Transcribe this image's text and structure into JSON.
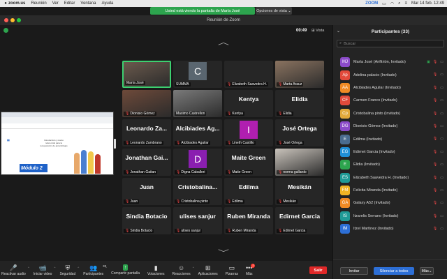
{
  "menubar": {
    "apple": "",
    "items": [
      "zoom.us",
      "Reunión",
      "Ver",
      "Editar",
      "Ventana",
      "Ayuda"
    ],
    "zoom_label": "ZOOM",
    "datetime": "Mar 14 feb.  12:49"
  },
  "share_banner": "Usted está viendo la pantalla de María José",
  "view_options": "Opciones de vista",
  "window_title": "Reunión de Zoom",
  "timer": "00:49",
  "view_label": "Vista",
  "shared_content": {
    "module": "Módulo 2",
    "headline": "Introducción y marco referencial para la recuperación de aprendizajes"
  },
  "tiles": [
    {
      "big": "",
      "label": "María José",
      "mic_muted": false,
      "kind": "photo",
      "color": "#6b5a4d"
    },
    {
      "big": "C",
      "label": "SUMMA",
      "mic_muted": false,
      "kind": "letter",
      "color": "#5a6670"
    },
    {
      "big": "",
      "label": "Elizabeth Saavedra H.",
      "mic_muted": true,
      "kind": "dark",
      "color": "#262626"
    },
    {
      "big": "",
      "label": "Marta Arauz",
      "mic_muted": true,
      "kind": "photo",
      "color": "#8a7360"
    },
    {
      "big": "",
      "label": "Dionisio Gómez",
      "mic_muted": true,
      "kind": "photo",
      "color": "#6e4a3a"
    },
    {
      "big": "",
      "label": "Maximo Castrellon",
      "mic_muted": false,
      "kind": "photo",
      "color": "#7a7a7a"
    },
    {
      "big": "Kentya",
      "label": "Kentya",
      "mic_muted": true,
      "kind": "name",
      "color": "#262626"
    },
    {
      "big": "Elidia",
      "label": "Elidia",
      "mic_muted": true,
      "kind": "name",
      "color": "#262626"
    },
    {
      "big": "Leonardo Za...",
      "label": "Leonardo Zambrano",
      "mic_muted": true,
      "kind": "name",
      "color": "#262626"
    },
    {
      "big": "Alcibiades Ag...",
      "label": "Alcibiades Aguilar",
      "mic_muted": true,
      "kind": "name",
      "color": "#262626"
    },
    {
      "big": "I",
      "label": "Lineth Castillo",
      "mic_muted": true,
      "kind": "letter",
      "color": "#b01fb0"
    },
    {
      "big": "José Ortega",
      "label": "José Ortega",
      "mic_muted": true,
      "kind": "name",
      "color": "#262626"
    },
    {
      "big": "Jonathan Gai...",
      "label": "Jonathan Gaitan",
      "mic_muted": true,
      "kind": "name",
      "color": "#262626"
    },
    {
      "big": "D",
      "label": "Digna Caballeri",
      "mic_muted": true,
      "kind": "letter",
      "color": "#8a1fb0"
    },
    {
      "big": "Maite Green",
      "label": "Maite Green",
      "mic_muted": true,
      "kind": "name",
      "color": "#262626"
    },
    {
      "big": "",
      "label": "norma gallardo",
      "mic_muted": true,
      "kind": "photo",
      "color": "#c9c3bb"
    },
    {
      "big": "Juan",
      "label": "Juan",
      "mic_muted": true,
      "kind": "name",
      "color": "#262626"
    },
    {
      "big": "Cristobalina...",
      "label": "Cristobalina pinto",
      "mic_muted": true,
      "kind": "name",
      "color": "#262626"
    },
    {
      "big": "Edilma",
      "label": "Edilma",
      "mic_muted": true,
      "kind": "name",
      "color": "#262626"
    },
    {
      "big": "Mesikán",
      "label": "Mesikán",
      "mic_muted": true,
      "kind": "name",
      "color": "#262626"
    },
    {
      "big": "Sindia Botacio",
      "label": "Sindia Botacio",
      "mic_muted": true,
      "kind": "name",
      "color": "#262626"
    },
    {
      "big": "ulises sanjur",
      "label": "ulises sanjur",
      "mic_muted": true,
      "kind": "name",
      "color": "#262626"
    },
    {
      "big": "Ruben Miranda",
      "label": "Ruben Miranda",
      "mic_muted": true,
      "kind": "name",
      "color": "#262626"
    },
    {
      "big": "Edirnet Garcia",
      "label": "Edirnet Garcia",
      "mic_muted": true,
      "kind": "name",
      "color": "#262626"
    }
  ],
  "toolbar": {
    "items": [
      {
        "label": "Reactivar audio",
        "icon": "mic-muted-icon",
        "glyph": "🎤",
        "red": true
      },
      {
        "label": "Iniciar video",
        "icon": "video-off-icon",
        "glyph": "📹",
        "red": true
      },
      {
        "label": "Seguridad",
        "icon": "shield-icon",
        "glyph": "⛨",
        "red": false
      },
      {
        "label": "Participantes",
        "icon": "participants-icon",
        "glyph": "👥",
        "red": false,
        "count": "33"
      },
      {
        "label": "Compartir pantalla",
        "icon": "share-screen-icon",
        "glyph": "↑",
        "red": false,
        "green": true
      },
      {
        "label": "Votaciones",
        "icon": "polls-icon",
        "glyph": "▮",
        "red": false
      },
      {
        "label": "Reacciones",
        "icon": "reactions-icon",
        "glyph": "☺",
        "red": false
      },
      {
        "label": "Aplicaciones",
        "icon": "apps-icon",
        "glyph": "⊞",
        "red": false
      },
      {
        "label": "Pizarras",
        "icon": "whiteboard-icon",
        "glyph": "▭",
        "red": false
      },
      {
        "label": "Más",
        "icon": "more-icon",
        "glyph": "•••",
        "red": false,
        "badge": "2"
      }
    ],
    "leave": "Salir"
  },
  "panel": {
    "title": "Participantes (33)",
    "search_placeholder": "Buscar",
    "participants": [
      {
        "initials": "MJ",
        "name": "María José (Anfitrión, Invitado)",
        "color": "#8b4bc9",
        "host": true
      },
      {
        "initials": "Ap",
        "name": "Adelina palacio (Invitado)",
        "color": "#e24a3b"
      },
      {
        "initials": "AA",
        "name": "Alcibiades Aguilar (Invitado)",
        "color": "#f08a24"
      },
      {
        "initials": "CF",
        "name": "Carmen Franco (Invitado)",
        "color": "#e24a3b"
      },
      {
        "initials": "Cp",
        "name": "Cristobalina pinto (Invitado)",
        "color": "#e2a93b"
      },
      {
        "initials": "DG",
        "name": "Dionisio Gómez (Invitado)",
        "color": "#8b4bc9"
      },
      {
        "initials": "E",
        "name": "Edilma (Invitado)",
        "color": "#4a6c8f"
      },
      {
        "initials": "EG",
        "name": "Edirnet Garcia (Invitado)",
        "color": "#1f8fd6"
      },
      {
        "initials": "E",
        "name": "Elidia (Invitado)",
        "color": "#2da44e"
      },
      {
        "initials": "ES",
        "name": "Elizabeth Saavedra H. (Invitado)",
        "color": "#1f9a96"
      },
      {
        "initials": "FM",
        "name": "Felicita Miranda (Invitado)",
        "color": "#f0b324"
      },
      {
        "initials": "GA",
        "name": "Galaxy A52 (Invitado)",
        "color": "#f08a24"
      },
      {
        "initials": "IS",
        "name": "Itzarelis Serrano (Invitado)",
        "color": "#1f9a96"
      },
      {
        "initials": "IM",
        "name": "Itzel Martínez (Invitado)",
        "color": "#2d6fd6"
      }
    ],
    "invite": "Invitar",
    "mute_all": "Silenciar a todos",
    "more": "Más"
  }
}
